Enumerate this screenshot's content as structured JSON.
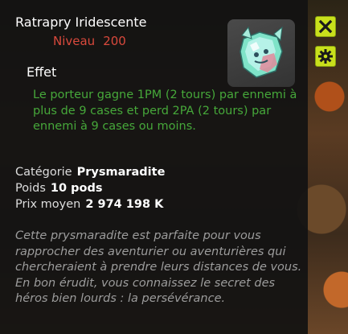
{
  "item": {
    "name": "Ratrapry Iridescente",
    "level_label": "Niveau",
    "level_value": "200"
  },
  "effect": {
    "title": "Effet",
    "text": "Le porteur gagne 1PM (2 tours) par ennemi à plus de 9 cases et perd 2PA (2 tours) par ennemi à 9 cases ou moins."
  },
  "stats": {
    "category_label": "Catégorie",
    "category_value": "Prysmaradite",
    "weight_label": "Poids",
    "weight_value": "10 pods",
    "price_label": "Prix moyen",
    "price_value": "2 974 198 K"
  },
  "description": "Cette prysmaradite est parfaite pour vous rapprocher des aventurier ou aventurières qui chercheraient à prendre leurs distances de vous. En bon érudit, vous connaissez le secret des héros bien lourds : la persévérance.",
  "buttons": {
    "close_icon": "close-icon",
    "settings_icon": "gear-icon"
  },
  "colors": {
    "level": "#d9493c",
    "effect": "#46a83a",
    "description": "#9c9c9c",
    "button": "#c9e01c"
  }
}
